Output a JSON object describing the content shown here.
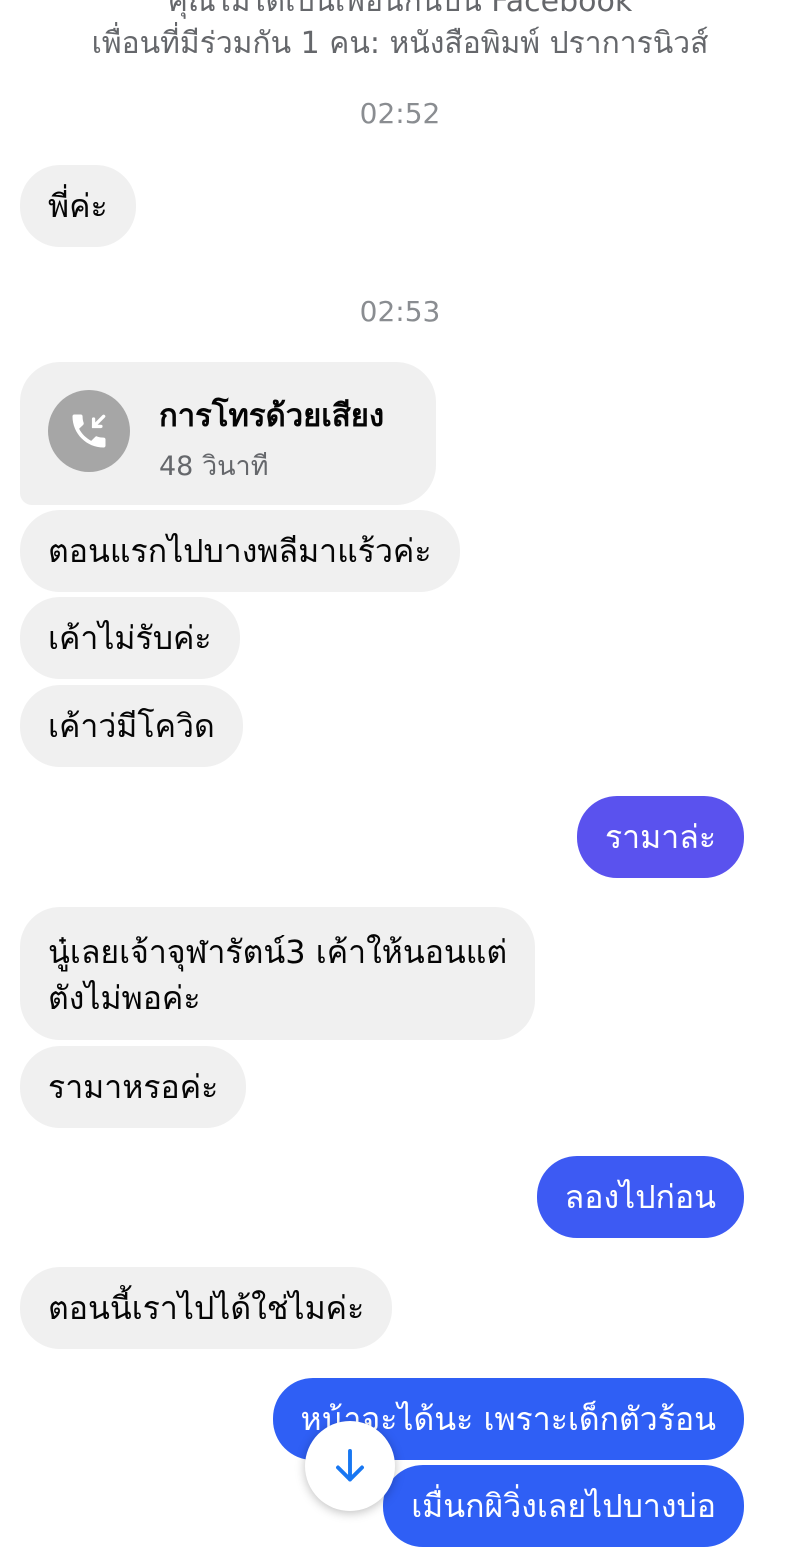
{
  "header": {
    "cut_line": "คุณไม่ได้เป็นเพื่อนกันบน Facebook",
    "mutual_friends": "เพื่อนที่มีร่วมกัน 1 คน: หนังสือพิมพ์ ปราการนิวส์"
  },
  "timestamps": [
    "02:52",
    "02:53"
  ],
  "call": {
    "title": "การโทรด้วยเสียง",
    "duration": "48 วินาที",
    "icon": "phone-incoming-icon"
  },
  "messages": [
    {
      "text": "พี่ค่ะ",
      "direction": "incoming"
    },
    {
      "text": "ตอนแรกไปบางพลีมาแร้วค่ะ",
      "direction": "incoming"
    },
    {
      "text": "เค้าไม่รับค่ะ",
      "direction": "incoming"
    },
    {
      "text": "เค้าว่มีโควิด",
      "direction": "incoming"
    },
    {
      "text": "รามาล่ะ",
      "direction": "outgoing"
    },
    {
      "text": "นู๋เลยเจ้าจุฬารัตน์3  เค้าให้นอนแต่",
      "direction": "incoming"
    },
    {
      "text": "ตังไม่พอค่ะ",
      "direction": "incoming"
    },
    {
      "text": "รามาหรอค่ะ",
      "direction": "incoming"
    },
    {
      "text": "ลองไปก่อน",
      "direction": "outgoing"
    },
    {
      "text": "ตอนนี้เราไปได้ใช่ไมค่ะ",
      "direction": "incoming"
    },
    {
      "text": "หน้าจะได้นะ เพราะเด็กตัวร้อน",
      "direction": "outgoing"
    },
    {
      "text": "เมื่นกผิวิ่งเลยไปบางบ่อ",
      "direction": "outgoing"
    }
  ],
  "colors": {
    "incoming_bubble": "#f0f0f0",
    "outgoing_purple": "#5a52ee",
    "outgoing_blue": "#2f5ff5",
    "timestamp": "#8a8d91"
  },
  "scroll_button": {
    "icon": "arrow-down-icon"
  }
}
